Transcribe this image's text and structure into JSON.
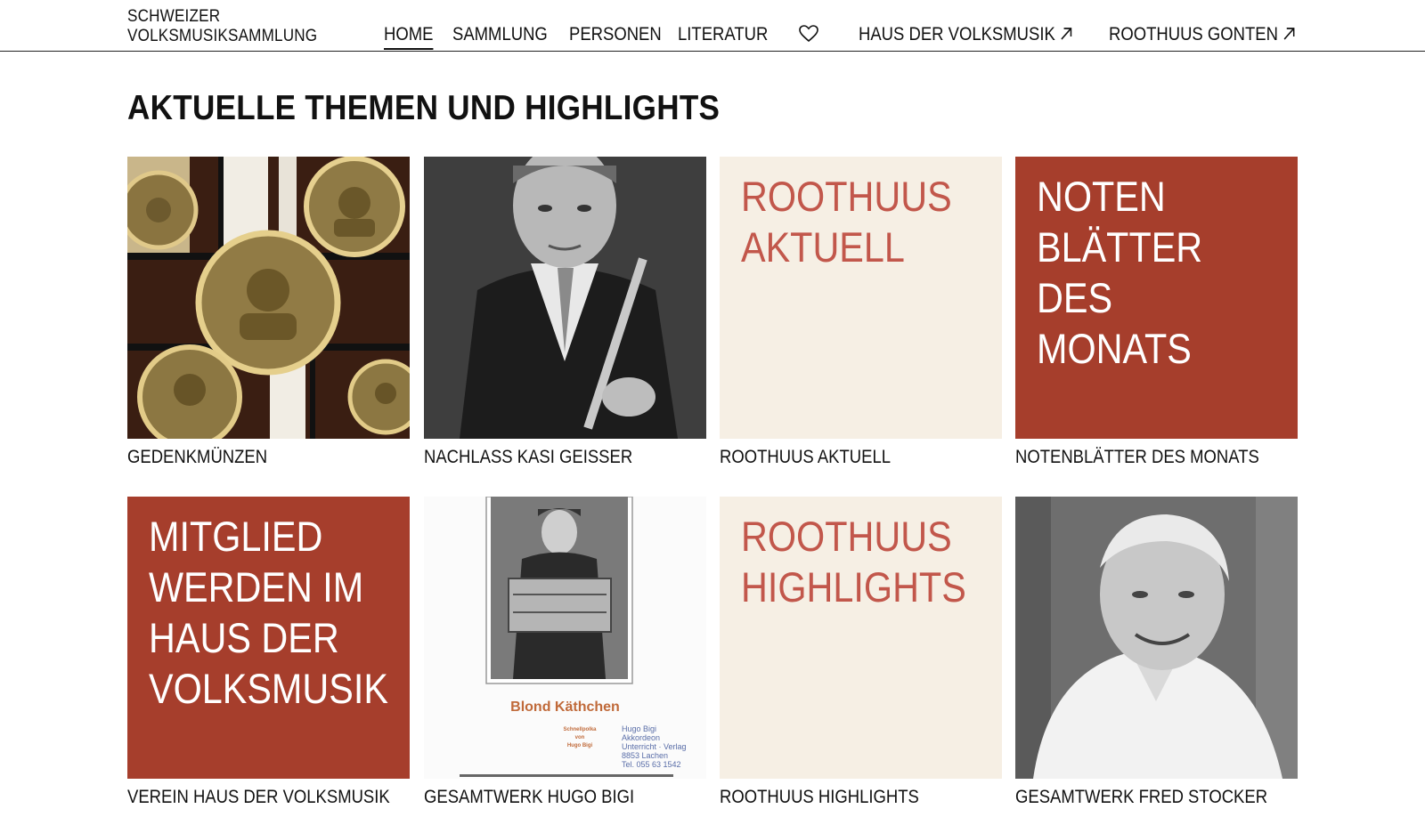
{
  "header": {
    "logo_line1": "SCHWEIZER",
    "logo_line2": "VOLKSMUSIKSAMMLUNG",
    "nav": [
      {
        "label": "HOME",
        "active": true
      },
      {
        "label": "SAMMLUNG"
      },
      {
        "label": "PERSONEN"
      },
      {
        "label": "LITERATUR"
      }
    ],
    "favorites_icon": "heart-icon",
    "external": [
      {
        "label": "HAUS DER VOLKSMUSIK",
        "icon": "arrow-up-right-icon"
      },
      {
        "label": "ROOTHUUS GONTEN",
        "icon": "arrow-up-right-icon"
      }
    ]
  },
  "main": {
    "title": "AKTUELLE THEMEN UND HIGHLIGHTS",
    "tiles": [
      {
        "caption": "GEDENKMÜNZEN",
        "kind": "photo",
        "image": "commemorative-coins"
      },
      {
        "caption": "NACHLASS KASI GEISSER",
        "kind": "photo",
        "image": "portrait-with-clarinet"
      },
      {
        "caption": "ROOTHUUS AKTUELL",
        "kind": "text",
        "text": "ROOTHUUS\nAKTUELL",
        "color": "#f6efe4",
        "text_color": "#c2574b"
      },
      {
        "caption": "NOTENBLÄTTER DES MONATS",
        "kind": "text",
        "text": "NOTEN\nBLÄTTER\nDES\nMONATS",
        "color": "#a63e2c",
        "text_color": "#ffffff"
      },
      {
        "caption": "VEREIN HAUS DER VOLKSMUSIK",
        "kind": "text",
        "text": "MITGLIED\nWERDEN IM\nHAUS DER\nVOLKSMUSIK",
        "color": "#a63e2c",
        "text_color": "#ffffff"
      },
      {
        "caption": "GESAMTWERK HUGO BIGI",
        "kind": "photo",
        "image": "sheet-music-cover",
        "sheet": {
          "title": "Blond Käthchen",
          "subtitle": "Schnellpolka\nvon\nHugo Bigi",
          "stamp": "Hugo Bigi\nAkkordeon\nUnterricht · Verlag\n8853 Lachen\nTel. 055 63 1542"
        }
      },
      {
        "caption": "ROOTHUUS HIGHLIGHTS",
        "kind": "text",
        "text": "ROOTHUUS\nHIGHLIGHTS",
        "color": "#f6efe4",
        "text_color": "#c2574b"
      },
      {
        "caption": "GESAMTWERK FRED STOCKER",
        "kind": "photo",
        "image": "portrait-smiling-man"
      }
    ]
  }
}
